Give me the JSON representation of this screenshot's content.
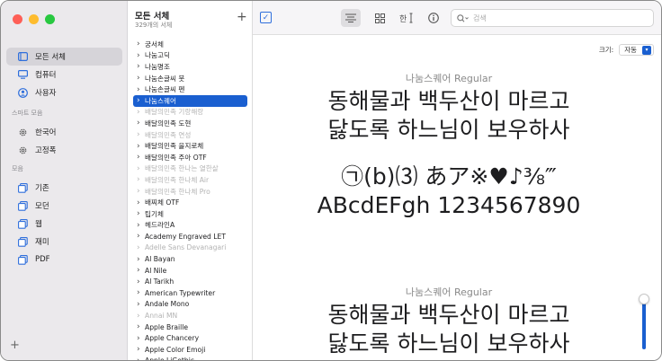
{
  "sidebar": {
    "items": [
      {
        "label": "모든 서체",
        "icon": "font-book-icon",
        "selected": true
      },
      {
        "label": "컴퓨터",
        "icon": "computer-icon",
        "selected": false
      },
      {
        "label": "사용자",
        "icon": "user-icon",
        "selected": false
      }
    ],
    "smart_section": "스마트 모음",
    "smart_items": [
      {
        "label": "한국어",
        "icon": "gear-icon"
      },
      {
        "label": "고정폭",
        "icon": "gear-icon"
      }
    ],
    "collection_section": "모음",
    "collection_items": [
      {
        "label": "기존",
        "icon": "collection-icon"
      },
      {
        "label": "모던",
        "icon": "collection-icon"
      },
      {
        "label": "웹",
        "icon": "collection-icon"
      },
      {
        "label": "재미",
        "icon": "collection-icon"
      },
      {
        "label": "PDF",
        "icon": "collection-icon"
      }
    ],
    "add_label": "+"
  },
  "list": {
    "title": "모든 서체",
    "subtitle": "329개의 서체",
    "fonts": [
      {
        "name": "궁서체",
        "state": "normal"
      },
      {
        "name": "나눔고딕",
        "state": "normal"
      },
      {
        "name": "나눔명조",
        "state": "normal"
      },
      {
        "name": "나눔손글씨 붓",
        "state": "normal"
      },
      {
        "name": "나눔손글씨 펜",
        "state": "normal"
      },
      {
        "name": "나눔스퀘어",
        "state": "selected"
      },
      {
        "name": "배달의민족 기랑해랑",
        "state": "dim"
      },
      {
        "name": "배달의민족 도현",
        "state": "normal"
      },
      {
        "name": "배달의민족 연성",
        "state": "dim"
      },
      {
        "name": "배달의민족 을지로체",
        "state": "normal"
      },
      {
        "name": "배달의민족 주아 OTF",
        "state": "normal"
      },
      {
        "name": "배달의민족 한나는 열한살",
        "state": "dim"
      },
      {
        "name": "배달의민족 한나체 Air",
        "state": "dim"
      },
      {
        "name": "배달의민족 한나체 Pro",
        "state": "dim"
      },
      {
        "name": "배찌체 OTF",
        "state": "normal"
      },
      {
        "name": "팁기체",
        "state": "normal"
      },
      {
        "name": "헤드라인A",
        "state": "normal"
      },
      {
        "name": "Academy Engraved LET",
        "state": "normal"
      },
      {
        "name": "Adelle Sans Devanagari",
        "state": "dim"
      },
      {
        "name": "Al Bayan",
        "state": "normal"
      },
      {
        "name": "Al Nile",
        "state": "normal"
      },
      {
        "name": "Al Tarikh",
        "state": "normal"
      },
      {
        "name": "American Typewriter",
        "state": "normal"
      },
      {
        "name": "Andale Mono",
        "state": "normal"
      },
      {
        "name": "Annai MN",
        "state": "dim"
      },
      {
        "name": "Apple Braille",
        "state": "normal"
      },
      {
        "name": "Apple Chancery",
        "state": "normal"
      },
      {
        "name": "Apple Color Emoji",
        "state": "normal"
      },
      {
        "name": "Apple LiGothic",
        "state": "normal"
      }
    ]
  },
  "toolbar": {
    "add": "+",
    "check": "✓",
    "search_placeholder": "검색"
  },
  "preview": {
    "size_label": "크기:",
    "size_value": "자동",
    "blocks": [
      {
        "font_name": "나눔스퀘어 Regular",
        "lines": [
          "동해물과 백두산이 마르고",
          "닳도록 하느님이 보우하사",
          "",
          "㉠(b)⑶ あア※♥♪⅜‴",
          "ABcdEFgh 1234567890"
        ]
      },
      {
        "font_name": "나눔스퀘어 Regular",
        "lines": [
          "동해물과 백두산이 마르고",
          "닳도록 하느님이 보우하사"
        ]
      }
    ],
    "slider_level": 0.85
  },
  "colors": {
    "accent": "#1a5fd0",
    "sidebar_bg": "#ebe9ec"
  }
}
